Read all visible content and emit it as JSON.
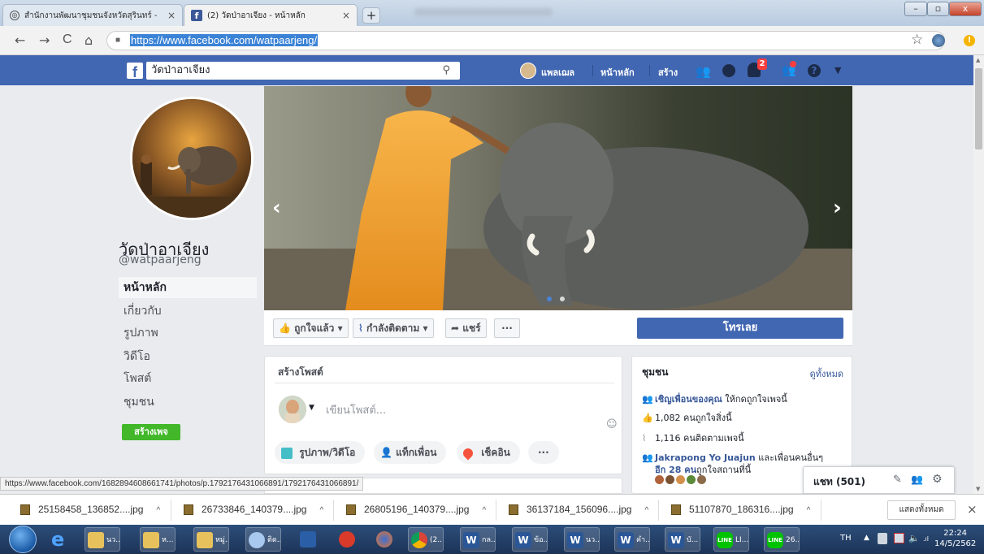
{
  "browser": {
    "tabs": [
      {
        "title": "สำนักงานพัฒนาชุมชนจังหวัดสุรินทร์ -",
        "close": "×"
      },
      {
        "title": "(2) วัดป่าอาเจียง - หน้าหลัก",
        "close": "×"
      }
    ],
    "new_tab": "+",
    "window_controls": {
      "minimize": "–",
      "maximize": "▫",
      "close": "x"
    },
    "nav": {
      "back": "←",
      "forward": "→",
      "reload": "C",
      "home": "⌂"
    },
    "url": "https://www.facebook.com/watpaarjeng/",
    "star": "☆"
  },
  "facebook_bar": {
    "logo": "f",
    "search_value": "วัดป่าอาเจียง",
    "user_name": "แพลเฌล",
    "home": "หน้าหลัก",
    "create": "สร้าง",
    "notification_count": "2"
  },
  "page": {
    "name": "วัดป่าอาเจียง",
    "handle": "@watpaarjeng",
    "left_nav": [
      "หน้าหลัก",
      "เกี่ยวกับ",
      "รูปภาพ",
      "วิดีโอ",
      "โพสต์",
      "ชุมชน"
    ],
    "create_page_button": "สร้างเพจ",
    "actions": {
      "liked": "ถูกใจแล้ว ▾",
      "following": "กำลังติดตาม ▾",
      "share": "แชร์",
      "more": "···",
      "call": "โทรเลย"
    }
  },
  "create_post": {
    "title": "สร้างโพสต์",
    "placeholder": "เขียนโพสต์...",
    "buttons": [
      "รูปภาพ/วิดีโอ",
      "แท็กเพื่อน",
      "เช็คอิน",
      "···"
    ]
  },
  "community": {
    "title": "ชุมชน",
    "see_all": "ดูทั้งหมด",
    "invite_link": "เชิญเพื่อนของคุณ",
    "invite_rest": " ให้กดถูกใจเพจนี้",
    "likes": "1,082 คนถูกใจสิ่งนี้",
    "followers": "1,116 คนติดตามเพจนี้",
    "friend_name": "Jakrapong Yo Juajun",
    "friend_rest": " และเพื่อนคนอื่นๆ",
    "friend_more": "อีก 28 คน",
    "friend_more_rest": "ถูกใจสถานที่นี้"
  },
  "chat": {
    "label": "แชท (501)"
  },
  "status_url": "https://www.facebook.com/1682894608661741/photos/p.1792176431066891/1792176431066891/",
  "downloads": {
    "files": [
      "25158458_136852....jpg",
      "26733846_140379....jpg",
      "26805196_140379....jpg",
      "36137184_156096....jpg",
      "51107870_186316....jpg"
    ],
    "show_all": "แสดงทั้งหมด",
    "close": "×"
  },
  "taskbar": {
    "items": [
      "นว...",
      "ห...",
      "หมู่...",
      "ติด...",
      "",
      "",
      "",
      "(2...",
      "กล...",
      "ข้อ...",
      "นว...",
      "คำ...",
      "บั...",
      "LI...",
      "26..."
    ],
    "lang": "TH",
    "time": "22:24",
    "date": "14/5/2562"
  }
}
